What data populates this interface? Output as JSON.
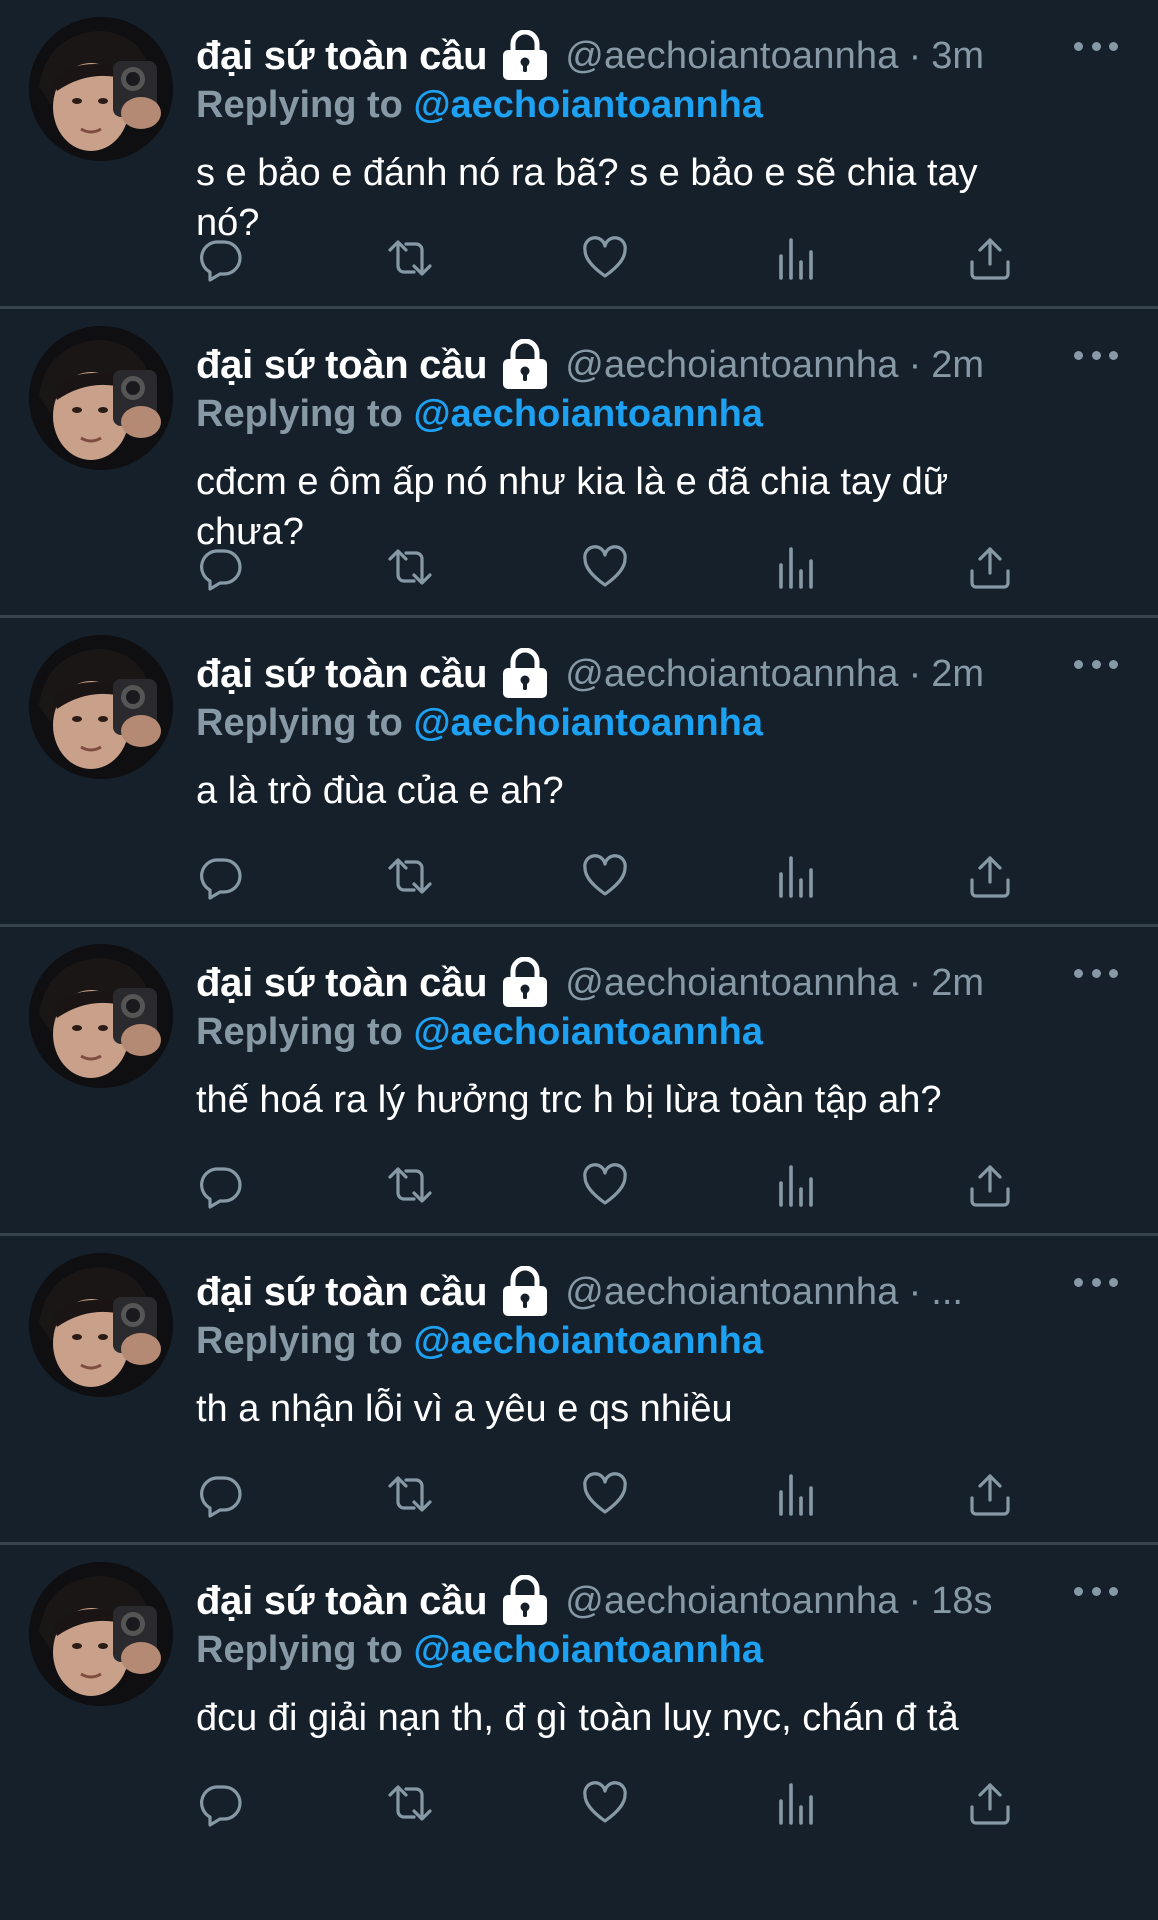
{
  "tweets": [
    {
      "name": "đại sứ toàn cầu",
      "handle": "@aechoiantoannha",
      "separator": "·",
      "time": "3m",
      "replying_prefix": "Replying to",
      "replying_to": "@aechoiantoannha",
      "text": "s e bảo e đánh nó ra bã? s e bảo e sẽ chia tay\nnó?"
    },
    {
      "name": "đại sứ toàn cầu",
      "handle": "@aechoiantoannha",
      "separator": "·",
      "time": "2m",
      "replying_prefix": "Replying to",
      "replying_to": "@aechoiantoannha",
      "text": "cđcm e ôm ấp nó như kia là e đã chia tay dữ\nchưa?"
    },
    {
      "name": "đại sứ toàn cầu",
      "handle": "@aechoiantoannha",
      "separator": "·",
      "time": "2m",
      "replying_prefix": "Replying to",
      "replying_to": "@aechoiantoannha",
      "text": "a là trò đùa của e ah?"
    },
    {
      "name": "đại sứ toàn cầu",
      "handle": "@aechoiantoannha",
      "separator": "·",
      "time": "2m",
      "replying_prefix": "Replying to",
      "replying_to": "@aechoiantoannha",
      "text": "thế hoá ra lý hưởng trc h bị lừa toàn tập ah?"
    },
    {
      "name": "đại sứ toàn cầu",
      "handle": "@aechoiantoannha",
      "separator": "·",
      "time": "...",
      "replying_prefix": "Replying to",
      "replying_to": "@aechoiantoannha",
      "text": "th a nhận lỗi vì a yêu e qs nhiều"
    },
    {
      "name": "đại sứ toàn cầu",
      "handle": "@aechoiantoannha",
      "separator": "·",
      "time": "18s",
      "replying_prefix": "Replying to",
      "replying_to": "@aechoiantoannha",
      "text": "đcu đi giải nạn th, đ gì toàn luỵ nyc, chán đ tả"
    }
  ],
  "icons": {
    "avatar": "profile-photo",
    "lock": "lock-icon",
    "more": "more-icon",
    "reply": "reply-icon",
    "retweet": "retweet-icon",
    "like": "heart-icon",
    "analytics": "analytics-icon",
    "share": "share-icon"
  },
  "colors": {
    "background": "#15202b",
    "divider": "#38444d",
    "secondary_text": "#8899a6",
    "link": "#1da1f2",
    "primary_text": "#ffffff"
  }
}
